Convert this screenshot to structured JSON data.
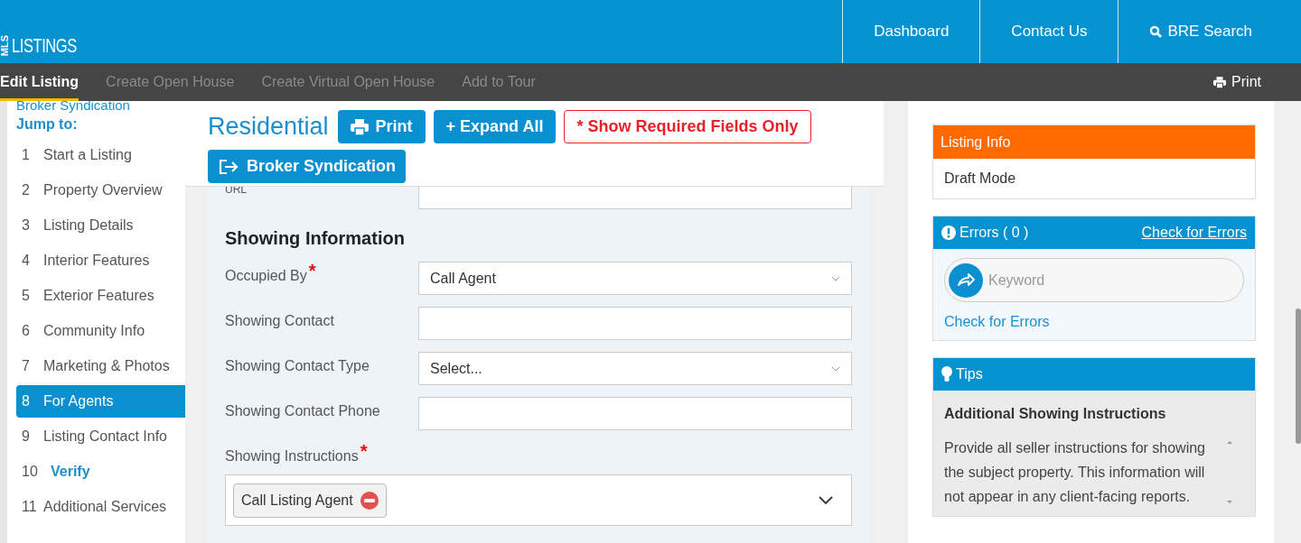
{
  "header": {
    "logo_top": "MLS",
    "logo_text": "LISTINGS",
    "nav": [
      {
        "label": "Dashboard",
        "kind": "plain"
      },
      {
        "label": "Contact Us",
        "kind": "plain"
      },
      {
        "label": "BRE Search",
        "kind": "search"
      }
    ]
  },
  "toolbar": {
    "tabs": [
      {
        "label": "Edit Listing",
        "selected": true
      },
      {
        "label": "Create Open House",
        "selected": false
      },
      {
        "label": "Create Virtual Open House",
        "selected": false
      },
      {
        "label": "Add to Tour",
        "selected": false
      }
    ],
    "print": "Print"
  },
  "sidebar": {
    "top_link": "Broker Syndication",
    "heading": "Jump to:",
    "items": [
      {
        "number": "1",
        "label": "Start a Listing",
        "selected": false,
        "kind": "step"
      },
      {
        "number": "2",
        "label": "Property Overview",
        "selected": false,
        "kind": "step"
      },
      {
        "number": "3",
        "label": "Listing Details",
        "selected": false,
        "kind": "step"
      },
      {
        "number": "4",
        "label": "Interior Features",
        "selected": false,
        "kind": "step"
      },
      {
        "number": "5",
        "label": "Exterior Features",
        "selected": false,
        "kind": "step"
      },
      {
        "number": "6",
        "label": "Community Info",
        "selected": false,
        "kind": "step"
      },
      {
        "number": "7",
        "label": "Marketing & Photos",
        "selected": false,
        "kind": "step"
      },
      {
        "number": "8",
        "label": "For Agents",
        "selected": true,
        "kind": "step"
      },
      {
        "number": "9",
        "label": "Listing Contact Info",
        "selected": false,
        "kind": "step"
      },
      {
        "number": "10",
        "label": "Verify",
        "selected": false,
        "kind": "verify"
      },
      {
        "number": "11",
        "label": "Additional Services",
        "selected": false,
        "kind": "step"
      }
    ]
  },
  "main": {
    "title": "Residential",
    "buttons": [
      {
        "label": "Print",
        "kind": "print"
      },
      {
        "label": "+ Expand All",
        "kind": "plain"
      },
      {
        "label": "* Show Required Fields Only",
        "kind": "outline"
      },
      {
        "label": "Broker Syndication",
        "kind": "syndication"
      }
    ],
    "url_label": "URL",
    "section_title": "Showing Information",
    "fields": [
      {
        "label": "Occupied By",
        "required_mark": "*",
        "kind": "select",
        "value": "Call Agent"
      },
      {
        "label": "Showing Contact",
        "kind": "text"
      },
      {
        "label": "Showing Contact Type",
        "kind": "select",
        "value": "Select..."
      },
      {
        "label": "Showing Contact Phone",
        "kind": "text"
      },
      {
        "label": "Showing Instructions",
        "required_mark": "*",
        "kind": "tags",
        "tags": [
          "Call Listing Agent"
        ]
      }
    ]
  },
  "right": {
    "listing_info": {
      "title": "Listing Info",
      "status": "Draft Mode"
    },
    "errors": {
      "title": "Errors ( 0 )",
      "link": "Check for Errors",
      "placeholder": "Keyword",
      "bottom_link": "Check for Errors"
    },
    "tips": {
      "title": "Tips",
      "heading": "Additional Showing Instructions",
      "text": "Provide all seller instructions for showing the subject property. This information will not appear in any client-facing reports."
    }
  }
}
